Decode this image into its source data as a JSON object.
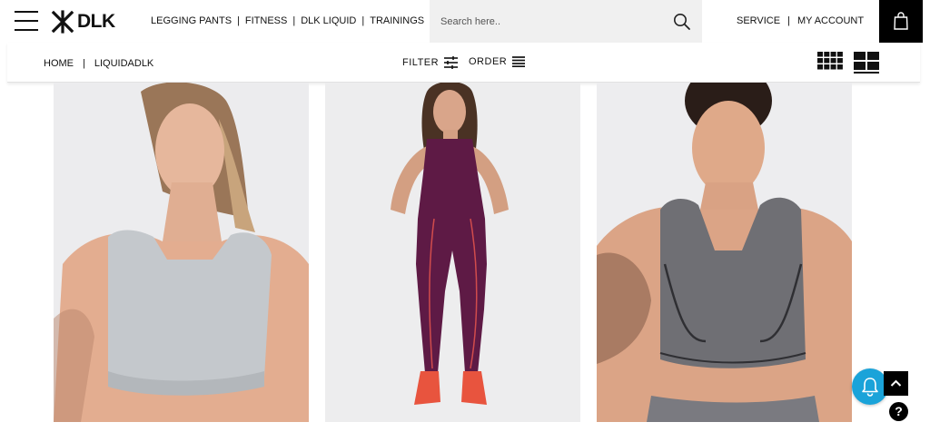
{
  "header": {
    "logo_text": "DLK",
    "nav": [
      "LEGGING PANTS",
      "FITNESS",
      "DLK LIQUID",
      "TRAININGS"
    ],
    "search_placeholder": "Search here..",
    "account_nav": [
      "SERVICE",
      "MY ACCOUNT"
    ]
  },
  "subbar": {
    "breadcrumb": [
      "HOME",
      "LIQUIDADLK"
    ],
    "filter_label": "FILTER",
    "order_label": "ORDER",
    "separator": "|"
  },
  "products": [
    {
      "name": "light-gray-sports-top",
      "color": "#c4c8cc"
    },
    {
      "name": "purple-jumpsuit",
      "color": "#5e1a45"
    },
    {
      "name": "heather-gray-sports-top",
      "color": "#6f6f74"
    }
  ],
  "floating": {
    "help_label": "?"
  },
  "colors": {
    "notify_blue": "#1aa3d9",
    "cart_black": "#000000",
    "search_bg": "#f0f0f0"
  }
}
